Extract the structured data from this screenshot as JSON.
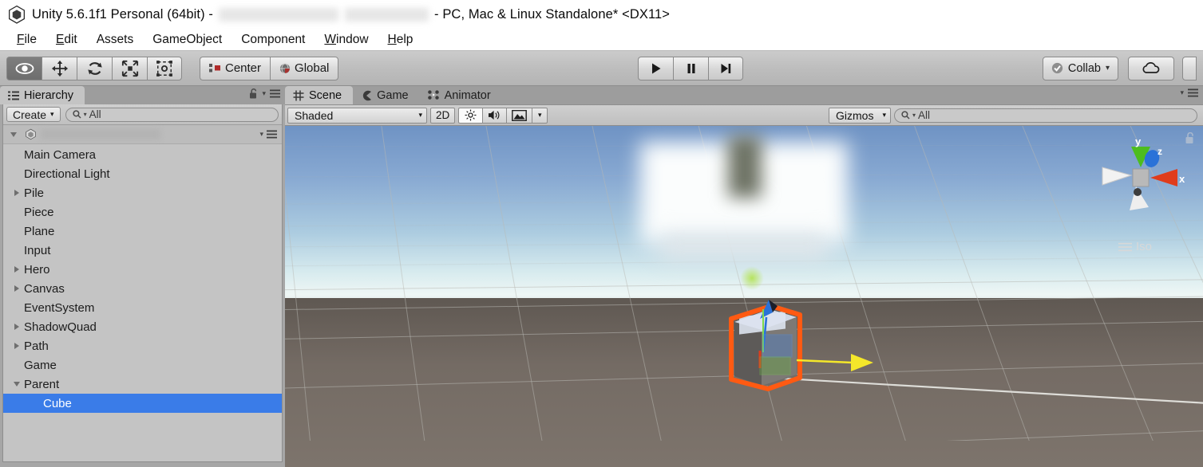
{
  "window": {
    "title_prefix": "Unity 5.6.1f1 Personal (64bit) -",
    "title_suffix": "- PC, Mac & Linux Standalone* <DX11>",
    "logo_icon": "unity-logo-icon"
  },
  "menubar": {
    "items": [
      {
        "label": "File",
        "accel": "F"
      },
      {
        "label": "Edit",
        "accel": "E"
      },
      {
        "label": "Assets",
        "accel": ""
      },
      {
        "label": "GameObject",
        "accel": ""
      },
      {
        "label": "Component",
        "accel": ""
      },
      {
        "label": "Window",
        "accel": "W"
      },
      {
        "label": "Help",
        "accel": "H"
      }
    ]
  },
  "toolbar": {
    "transform_tools": [
      {
        "name": "hand-tool",
        "icon": "eye-icon",
        "active": true
      },
      {
        "name": "move-tool",
        "icon": "move-arrows-icon",
        "active": false
      },
      {
        "name": "rotate-tool",
        "icon": "rotate-icon",
        "active": false
      },
      {
        "name": "scale-tool",
        "icon": "scale-icon",
        "active": false
      },
      {
        "name": "rect-tool",
        "icon": "rect-transform-icon",
        "active": false
      }
    ],
    "pivot_mode_label": "Center",
    "pivot_mode_icon": "pivot-center-icon",
    "pivot_rotation_label": "Global",
    "pivot_rotation_icon": "globe-icon",
    "play_label": "play-icon",
    "pause_label": "pause-icon",
    "step_label": "step-icon",
    "collab_label": "Collab",
    "collab_icon": "collab-check-icon",
    "cloud_icon": "cloud-icon",
    "account_icon": "account-icon"
  },
  "hierarchy": {
    "tab_label": "Hierarchy",
    "tab_icon": "hierarchy-icon",
    "lock_icon": "unlocked-padlock-icon",
    "menu_icon": "panel-menu-icon",
    "create_label": "Create",
    "search_value": "All",
    "search_placeholder": "All",
    "search_icon": "search-icon",
    "scene_node": {
      "label": "",
      "redacted": true,
      "icon": "unity-scene-icon",
      "expanded": true
    },
    "items": [
      {
        "label": "Main Camera",
        "depth": 1,
        "twisty": "none",
        "selected": false
      },
      {
        "label": "Directional Light",
        "depth": 1,
        "twisty": "none",
        "selected": false
      },
      {
        "label": "Pile",
        "depth": 1,
        "twisty": "collapsed",
        "selected": false
      },
      {
        "label": "Piece",
        "depth": 1,
        "twisty": "none",
        "selected": false
      },
      {
        "label": "Plane",
        "depth": 1,
        "twisty": "none",
        "selected": false
      },
      {
        "label": "Input",
        "depth": 1,
        "twisty": "none",
        "selected": false
      },
      {
        "label": "Hero",
        "depth": 1,
        "twisty": "collapsed",
        "selected": false
      },
      {
        "label": "Canvas",
        "depth": 1,
        "twisty": "collapsed",
        "selected": false
      },
      {
        "label": "EventSystem",
        "depth": 1,
        "twisty": "none",
        "selected": false
      },
      {
        "label": "ShadowQuad",
        "depth": 1,
        "twisty": "collapsed",
        "selected": false
      },
      {
        "label": "Path",
        "depth": 1,
        "twisty": "collapsed",
        "selected": false
      },
      {
        "label": "Game",
        "depth": 1,
        "twisty": "none",
        "selected": false
      },
      {
        "label": "Parent",
        "depth": 1,
        "twisty": "expanded",
        "selected": false
      },
      {
        "label": "Cube",
        "depth": 2,
        "twisty": "none",
        "selected": true
      }
    ]
  },
  "scene_panel": {
    "tabs": [
      {
        "label": "Scene",
        "icon": "scene-grid-icon",
        "active": true
      },
      {
        "label": "Game",
        "icon": "game-pacman-icon",
        "active": false
      },
      {
        "label": "Animator",
        "icon": "animator-icon",
        "active": false
      }
    ],
    "menu_icon": "panel-menu-icon",
    "draw_mode_label": "Shaded",
    "two_d_label": "2D",
    "lighting_icon": "sun-icon",
    "audio_icon": "speaker-icon",
    "effects_icon": "image-effects-icon",
    "effects_dropdown_icon": "chevron-down-icon",
    "gizmos_label": "Gizmos",
    "search_value": "All",
    "search_placeholder": "All",
    "search_icon": "search-icon",
    "viewport": {
      "projection_label": "Iso",
      "projection_icon": "iso-lines-icon",
      "lock_icon": "viewport-lock-icon",
      "axis_gizmo": {
        "x_label": "x",
        "x_color": "#e03c1c",
        "y_label": "y",
        "y_color": "#4dbd1e",
        "z_label": "z",
        "z_color": "#2a72d8"
      },
      "selection": {
        "object_name": "Cube",
        "outline_color": "#ff5a12",
        "gizmo_x_color": "#e03c1c",
        "gizmo_y_color": "#4dbd1e",
        "gizmo_z_color": "#2a72d8",
        "direction_arrow_color": "#f4e72a"
      },
      "redacted_overlay": true
    }
  },
  "colors": {
    "selection_blue": "#3a7ce8",
    "panel_gray": "#c4c4c4",
    "chrome_gray": "#bdbdbd",
    "accent_orange": "#ff5a12"
  }
}
